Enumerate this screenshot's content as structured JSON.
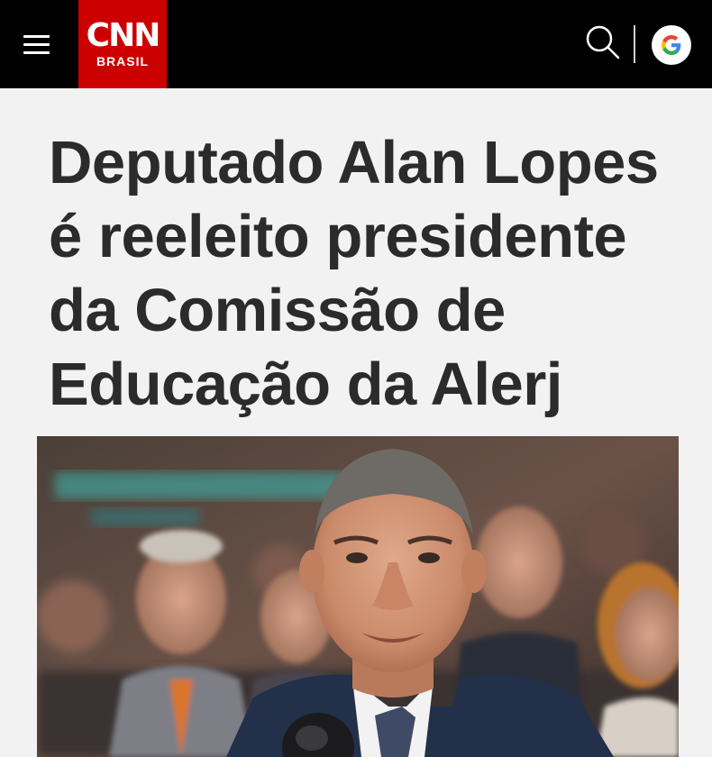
{
  "header": {
    "menu_icon": "hamburger-menu-icon",
    "logo": {
      "wordmark": "CNN",
      "subtitle": "BRASIL",
      "brand_color": "#cc0000"
    },
    "search_icon": "search-icon",
    "google_icon": "google-g-icon",
    "background": "#000000"
  },
  "article": {
    "headline": "Deputado Alan Lopes é reeleito presidente da Comissão de Educação da Alerj",
    "hero_image": "photo-of-deputy-speaking-to-press"
  }
}
